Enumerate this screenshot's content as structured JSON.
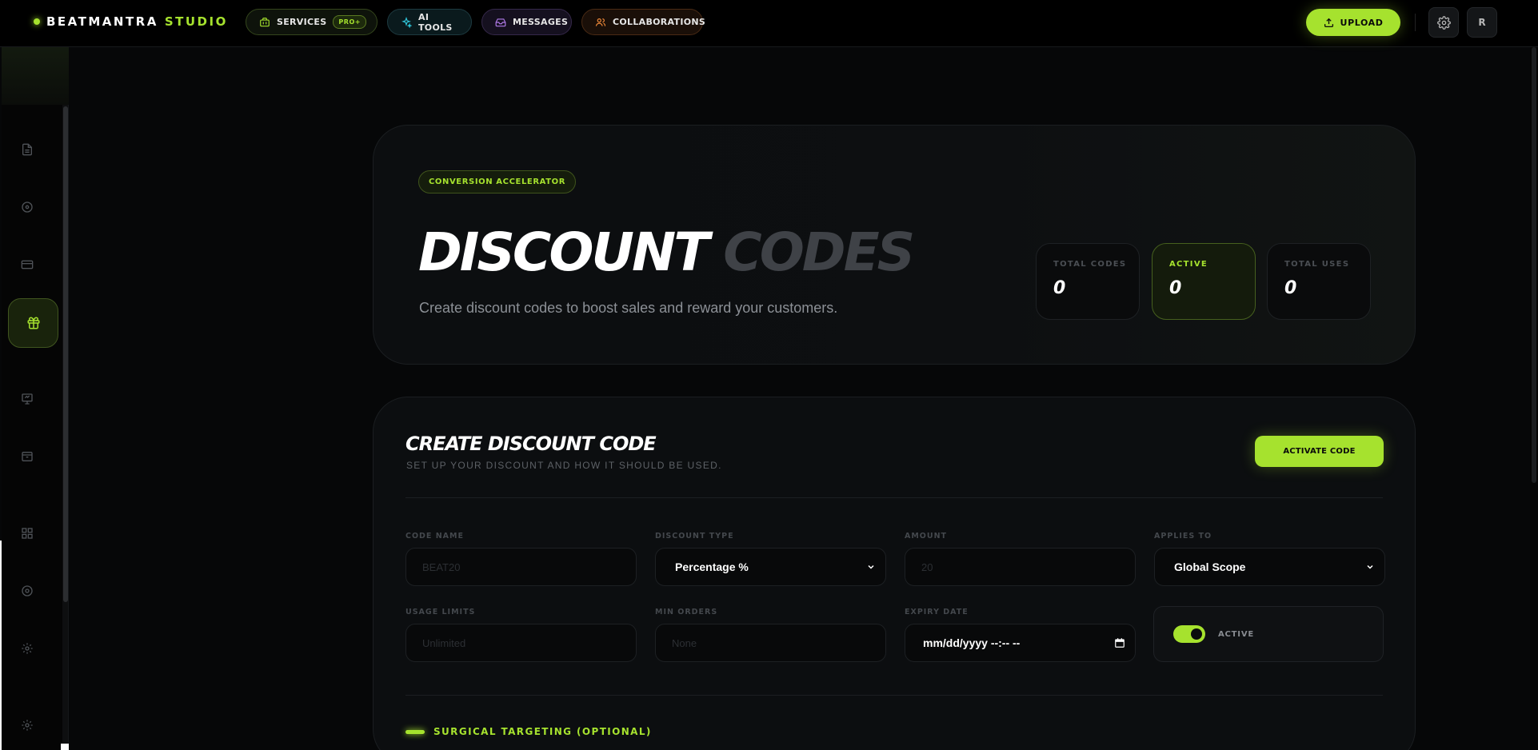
{
  "brand": {
    "name": "BEATMANTRA",
    "accent": "STUDIO",
    "accent_color": "#a6e22e"
  },
  "nav": {
    "services": {
      "label": "SERVICES",
      "badge": "PRO+",
      "icon": "briefcase-icon"
    },
    "ai_tools": {
      "label": "AI TOOLS",
      "icon": "sparkles-icon"
    },
    "messages": {
      "label": "MESSAGES",
      "icon": "inbox-icon"
    },
    "collaborations": {
      "label": "COLLABORATIONS",
      "icon": "users-icon"
    }
  },
  "header_actions": {
    "upload_label": "UPLOAD",
    "settings_icon": "gear-icon",
    "avatar_initial": "R"
  },
  "sidebar": {
    "items": [
      {
        "icon": "document-icon",
        "active": false
      },
      {
        "icon": "disc-icon",
        "active": false
      },
      {
        "icon": "credit-card-icon",
        "active": false
      },
      {
        "icon": "gift-icon",
        "active": true
      },
      {
        "icon": "presentation-icon",
        "active": false
      },
      {
        "icon": "archive-icon",
        "active": false
      },
      {
        "icon": "grid-icon",
        "active": false
      },
      {
        "icon": "record-icon",
        "active": false
      },
      {
        "icon": "gear-icon",
        "active": false
      },
      {
        "icon": "gear-icon",
        "active": false
      }
    ]
  },
  "hero": {
    "badge": "CONVERSION ACCELERATOR",
    "title_primary": "DISCOUNT",
    "title_secondary": "CODES",
    "subtitle": "Create discount codes to boost sales and reward your customers.",
    "stats": [
      {
        "label": "TOTAL CODES",
        "value": "0"
      },
      {
        "label": "ACTIVE",
        "value": "0"
      },
      {
        "label": "TOTAL USES",
        "value": "0"
      }
    ]
  },
  "create": {
    "title": "CREATE DISCOUNT CODE",
    "subtitle": "SET UP YOUR DISCOUNT AND HOW IT SHOULD BE USED.",
    "activate_label": "ACTIVATE CODE",
    "fields": {
      "code_name": {
        "label": "CODE NAME",
        "placeholder": "BEAT20",
        "value": ""
      },
      "discount_type": {
        "label": "DISCOUNT TYPE",
        "value": "Percentage %"
      },
      "amount": {
        "label": "AMOUNT",
        "placeholder": "20",
        "value": ""
      },
      "applies_to": {
        "label": "APPLIES TO",
        "value": "Global Scope"
      },
      "usage_limits": {
        "label": "USAGE LIMITS",
        "placeholder": "Unlimited",
        "value": ""
      },
      "min_orders": {
        "label": "MIN ORDERS",
        "placeholder": "None",
        "value": ""
      },
      "expiry_date": {
        "label": "EXPIRY DATE",
        "value": "mm/dd/yyyy --:-- --"
      },
      "active_toggle": {
        "label": "ACTIVE",
        "on": true
      }
    },
    "targeting_label": "SURGICAL TARGETING (OPTIONAL)"
  }
}
